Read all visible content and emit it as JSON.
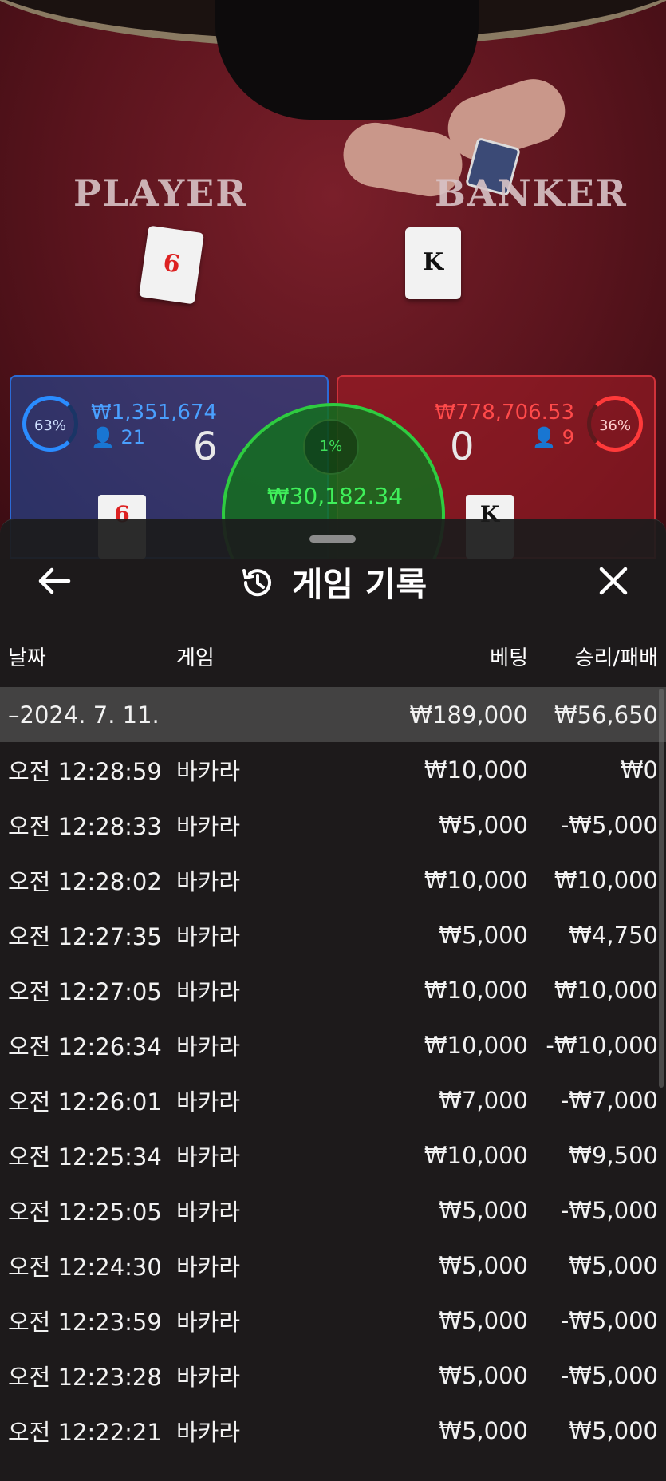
{
  "table": {
    "player_label": "PLAYER",
    "banker_label": "BANKER",
    "player_card": "6",
    "banker_card": "K",
    "player_panel": {
      "percent": "63%",
      "amount": "₩1,351,674",
      "count": "21",
      "score": "6",
      "card": "6"
    },
    "banker_panel": {
      "percent": "36%",
      "amount": "₩778,706.53",
      "count": "9",
      "score": "0",
      "card": "K"
    },
    "tie": {
      "percent": "1%",
      "amount": "₩30,182.34"
    },
    "colors": {
      "player_blue": "#2c6bd6",
      "banker_red": "#d0323a",
      "tie_green": "#2ecc40"
    }
  },
  "history": {
    "title": "게임 기록",
    "icons": {
      "back": "arrow-left-icon",
      "history": "history-clock-icon",
      "close": "close-icon"
    },
    "columns": {
      "date": "날짜",
      "game": "게임",
      "bet": "베팅",
      "result": "승리/패배"
    },
    "date_group": {
      "date": "–2024. 7. 11.",
      "bet": "₩189,000",
      "result": "₩56,650"
    },
    "rows": [
      {
        "time": "오전 12:28:59",
        "game": "바카라",
        "bet": "₩10,000",
        "result": "₩0"
      },
      {
        "time": "오전 12:28:33",
        "game": "바카라",
        "bet": "₩5,000",
        "result": "-₩5,000"
      },
      {
        "time": "오전 12:28:02",
        "game": "바카라",
        "bet": "₩10,000",
        "result": "₩10,000"
      },
      {
        "time": "오전 12:27:35",
        "game": "바카라",
        "bet": "₩5,000",
        "result": "₩4,750"
      },
      {
        "time": "오전 12:27:05",
        "game": "바카라",
        "bet": "₩10,000",
        "result": "₩10,000"
      },
      {
        "time": "오전 12:26:34",
        "game": "바카라",
        "bet": "₩10,000",
        "result": "-₩10,000"
      },
      {
        "time": "오전 12:26:01",
        "game": "바카라",
        "bet": "₩7,000",
        "result": "-₩7,000"
      },
      {
        "time": "오전 12:25:34",
        "game": "바카라",
        "bet": "₩10,000",
        "result": "₩9,500"
      },
      {
        "time": "오전 12:25:05",
        "game": "바카라",
        "bet": "₩5,000",
        "result": "-₩5,000"
      },
      {
        "time": "오전 12:24:30",
        "game": "바카라",
        "bet": "₩5,000",
        "result": "₩5,000"
      },
      {
        "time": "오전 12:23:59",
        "game": "바카라",
        "bet": "₩5,000",
        "result": "-₩5,000"
      },
      {
        "time": "오전 12:23:28",
        "game": "바카라",
        "bet": "₩5,000",
        "result": "-₩5,000"
      },
      {
        "time": "오전 12:22:21",
        "game": "바카라",
        "bet": "₩5,000",
        "result": "₩5,000"
      }
    ]
  }
}
